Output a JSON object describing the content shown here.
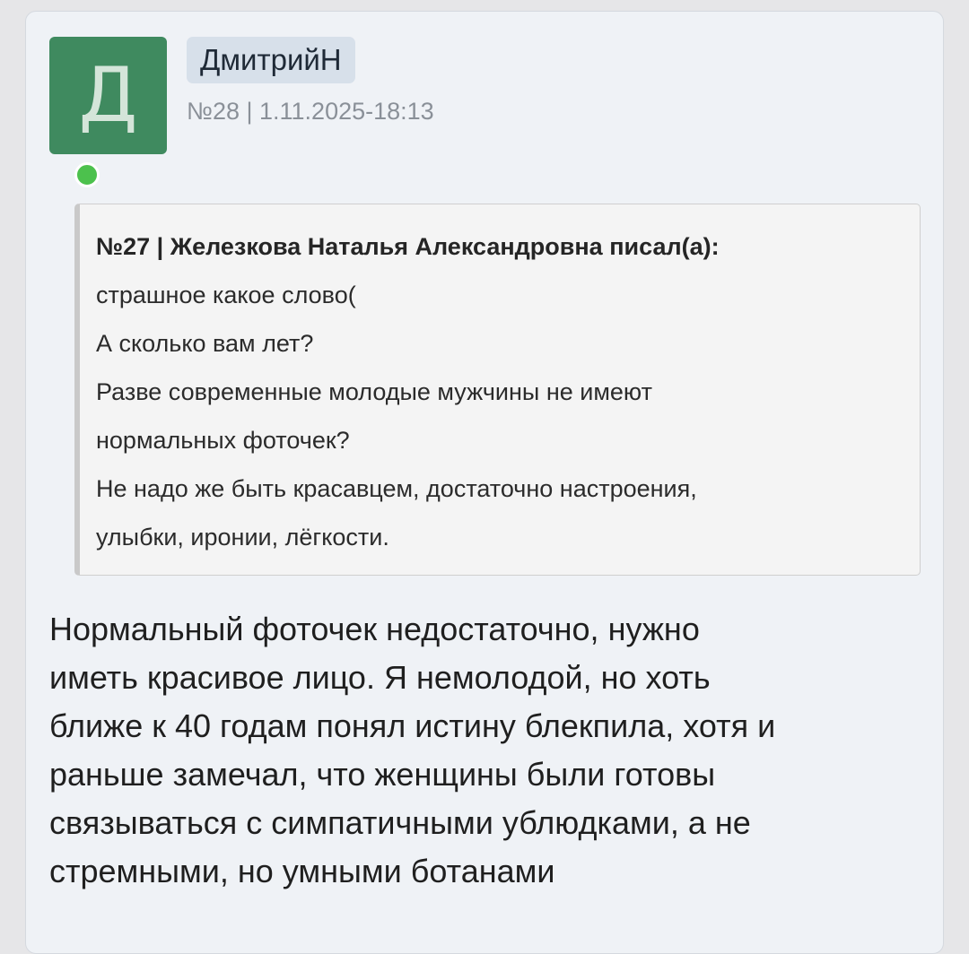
{
  "post": {
    "author": "ДмитрийН",
    "avatar_letter": "Д",
    "meta": "№28 | 1.11.2025-18:13",
    "online_status": "online",
    "colors": {
      "avatar_bg": "#3f8a5f",
      "online_dot": "#4cc14d",
      "username_badge_bg": "#d7e0ea",
      "card_bg": "#eff2f6",
      "quote_bg": "#f4f4f4"
    },
    "quote": {
      "header": "№27 | Железкова Наталья Александровна писал(а):",
      "lines": [
        "страшное какое слово(",
        "А сколько вам лет?",
        "Разве современные молодые мужчины не имеют",
        "нормальных фоточек?",
        "Не надо же быть красавцем, достаточно настроения,",
        "улыбки, иронии, лёгкости."
      ]
    },
    "reply_lines": [
      "Нормальный фоточек недостаточно, нужно",
      "иметь красивое лицо. Я немолодой, но хоть",
      "ближе к 40 годам понял истину блекпила, хотя и",
      "раньше замечал, что женщины были готовы",
      "связываться с симпатичными ублюдками, а не",
      "стремными, но умными ботанами"
    ]
  }
}
